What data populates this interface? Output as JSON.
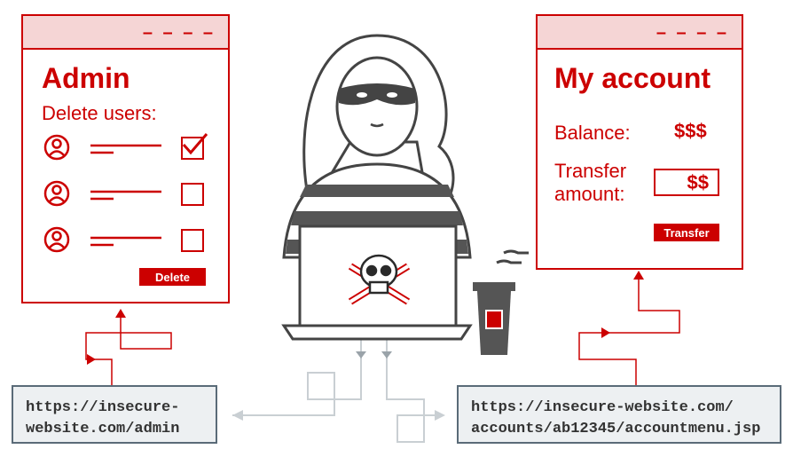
{
  "admin_panel": {
    "title": "Admin",
    "subtitle": "Delete users:",
    "users": [
      {
        "checked": true
      },
      {
        "checked": false
      },
      {
        "checked": false
      }
    ],
    "delete_button": "Delete"
  },
  "account_panel": {
    "title": "My account",
    "balance_label": "Balance:",
    "balance_value": "$$$",
    "transfer_label_line1": "Transfer",
    "transfer_label_line2": "amount:",
    "transfer_value": "$$",
    "transfer_button": "Transfer"
  },
  "window_bar_dashes": "– – – –",
  "urls": {
    "admin_line1": "https://insecure-",
    "admin_line2": "website.com/admin",
    "account_line1": "https://insecure-website.com/",
    "account_line2": "accounts/ab12345/accountmenu.jsp"
  },
  "colors": {
    "accent": "#cc0000",
    "accent_light": "#f5d5d5",
    "url_bg": "#edf0f2",
    "url_border": "#5a6b78",
    "connector": "#c9cfd3"
  }
}
